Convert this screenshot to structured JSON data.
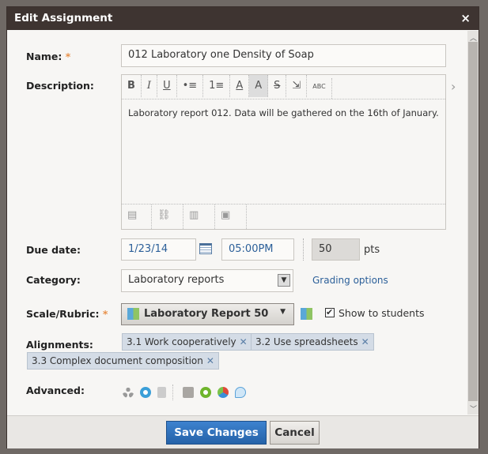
{
  "dialog": {
    "title": "Edit Assignment",
    "close": "×"
  },
  "name": {
    "label": "Name:",
    "required": "*",
    "value": "012 Laboratory one Density of Soap"
  },
  "description": {
    "label": "Description:",
    "toolbar": [
      "B",
      "I",
      "U",
      "•≡",
      "1≡",
      "A",
      "A",
      "S",
      "⇲",
      "ABC"
    ],
    "text": "Laboratory report 012. Data will be gathered on the 16th of January.",
    "more": "›"
  },
  "due": {
    "label": "Due date:",
    "date": "1/23/14",
    "time": "05:00PM",
    "points": "50",
    "points_unit": "pts"
  },
  "category": {
    "label": "Category:",
    "value": "Laboratory reports",
    "grading_link": "Grading options"
  },
  "scale": {
    "label": "Scale/Rubric:",
    "required": "*",
    "value": "Laboratory Report 50",
    "show_to_students": "Show to students",
    "checked": true
  },
  "alignments": {
    "label": "Alignments:",
    "tags": [
      "3.1 Work cooperatively",
      "3.2 Use spreadsheets",
      "3.3 Complex document composition"
    ],
    "remove": "✕"
  },
  "advanced": {
    "label": "Advanced:"
  },
  "footer": {
    "save": "Save Changes",
    "cancel": "Cancel"
  },
  "colors": {
    "header": "#3e3431",
    "save": "#2e6db4"
  }
}
